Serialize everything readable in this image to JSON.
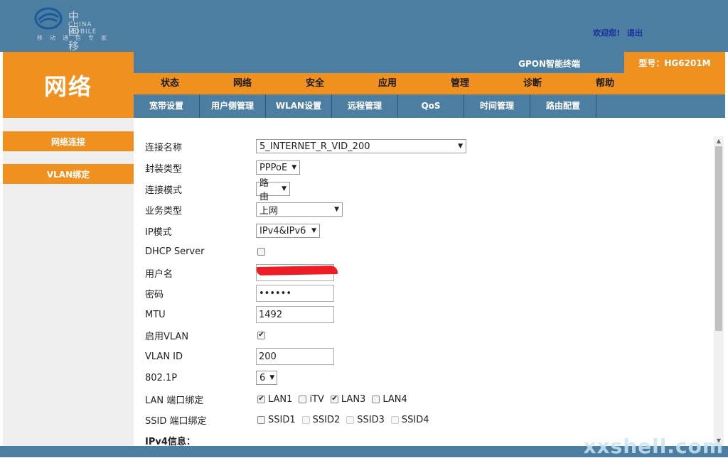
{
  "header": {
    "logo_cn": "中国移动通信",
    "logo_en": "CHINA MOBILE",
    "logo_sub": "移动通信专家",
    "welcome": "欢迎您!",
    "logout": "退出"
  },
  "brand": {
    "title": "网络"
  },
  "infobar": {
    "product": "GPON智能终端",
    "model": "型号：HG6201M"
  },
  "mainnav": [
    "状态",
    "网络",
    "安全",
    "应用",
    "管理",
    "诊断",
    "帮助"
  ],
  "subnav": [
    "宽带设置",
    "用户侧管理",
    "WLAN设置",
    "远程管理",
    "QoS",
    "时间管理",
    "路由配置"
  ],
  "sidebar": [
    "网络连接",
    "VLAN绑定"
  ],
  "form": {
    "connection_name": {
      "label": "连接名称",
      "value": "5_INTERNET_R_VID_200"
    },
    "encapsulation": {
      "label": "封装类型",
      "value": "PPPoE"
    },
    "connection_mode": {
      "label": "连接模式",
      "value": "路由"
    },
    "service_type": {
      "label": "业务类型",
      "value": "上网"
    },
    "ip_mode": {
      "label": "IP模式",
      "value": "IPv4&IPv6"
    },
    "dhcp_server": {
      "label": "DHCP Server",
      "checked": false
    },
    "username": {
      "label": "用户名",
      "value": ""
    },
    "password": {
      "label": "密码",
      "value": "••••••"
    },
    "mtu": {
      "label": "MTU",
      "value": "1492"
    },
    "enable_vlan": {
      "label": "启用VLAN",
      "checked": true
    },
    "vlan_id": {
      "label": "VLAN ID",
      "value": "200"
    },
    "p8021": {
      "label": "802.1P",
      "value": "6"
    },
    "lan_binding": {
      "label": "LAN 端口绑定",
      "options": [
        {
          "name": "LAN1",
          "checked": true
        },
        {
          "name": "iTV",
          "checked": false
        },
        {
          "name": "LAN3",
          "checked": true
        },
        {
          "name": "LAN4",
          "checked": false
        }
      ]
    },
    "ssid_binding": {
      "label": "SSID 端口绑定",
      "options": [
        {
          "name": "SSID1",
          "checked": false
        },
        {
          "name": "SSID2",
          "checked": false
        },
        {
          "name": "SSID3",
          "checked": false
        },
        {
          "name": "SSID4",
          "checked": false
        }
      ]
    },
    "ipv4_section": "IPv4信息："
  },
  "watermark": "xxshell.com",
  "colors": {
    "orange": "#f0901f",
    "blue": "#4b7ea0"
  }
}
